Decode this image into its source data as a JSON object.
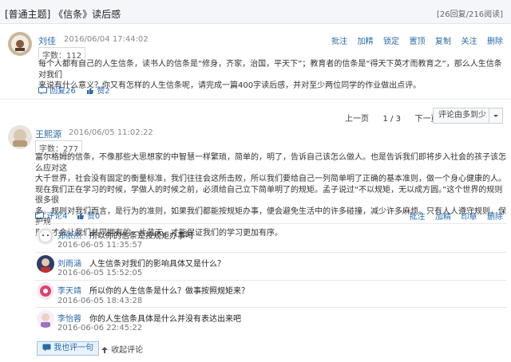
{
  "header": {
    "title": "[普通主题] 《信条》读后感",
    "stats": "[26回复/216阅读]"
  },
  "post": {
    "author": "刘佳",
    "time": "2016/06/04 17:44:02",
    "actions": [
      "批注",
      "加精",
      "锁定",
      "置顶",
      "复制",
      "关注",
      "删除"
    ],
    "word_count": "字数：112",
    "body": [
      "每个人都有自己的人生信条，读书人的信条是“修身，齐家，治国，平天下”；教育者的信条是“得天下英才而教育之”，那么人生信条对我们",
      "来说有什么意义？你又有怎样的人生信条呢，请完成一篇400字读后感，并对至少两位同学的作业做出点评。"
    ],
    "replies": "回复26",
    "likes": "赞2"
  },
  "pager": {
    "prev": "上一页",
    "page": "1 / 3",
    "next": "下一页",
    "sort": "评论由多到少"
  },
  "reply": {
    "author": "王熙源",
    "time": "2016/06/05 11:02:22",
    "word_count": "字数：277",
    "body": [
      "富尔格姆的信条，不像那些大思想家的中智慧一样繁琐，简单的，明了，告诉自己该怎么做人。也是告诉我们即将步入社会的孩子该怎么应对这",
      "大千世界，社会没有固定的衡量标准，我们往往会这所击败，所以我们要给自己一列简单明了正确的基本准则，做一个身心健康的人。",
      "现在我们正在学习的时候，学做人的时候之前，必须给自己立下简单明了的规矩。孟子说过“不以规矩，无以成方圆。”这个世界的规则很多很",
      "多。规则对我们而言，是行为的准则，如果我们都能按规矩办事，便会避免生活中的许多碰撞，减少许多麻烦。只有人人遵守规则，保护规",
      "则，才会让我们共同拥有的一片蓝天，才能保证我们的学习更加有序。"
    ],
    "comments": "评论4",
    "likes": "赞0",
    "actions": [
      "批注",
      "加精",
      "印章",
      "删除"
    ]
  },
  "comments": [
    {
      "name": "郑依然",
      "text": "所以你的信条是按规矩办事吗",
      "time": "2016-06-05 11:35:57"
    },
    {
      "name": "刘雨涵",
      "text": "人生信条对我们的影响具体又是什么？",
      "time": "2016-06-05 15:52:05"
    },
    {
      "name": "李天靖",
      "text": "所以你的人生信条是什么？做事按照规矩来？",
      "time": "2016-06-05 18:43:28"
    },
    {
      "name": "李怡蓉",
      "text": "你的人生信条具体是什么并没有表达出来吧",
      "time": "2016-06-06 22:45:22"
    }
  ],
  "footer": {
    "reply_button": "我也评一句",
    "collapse": "收起评论"
  },
  "colors": {
    "link": "#2a6aa8",
    "topbar_bg": "#f4f6f9"
  }
}
